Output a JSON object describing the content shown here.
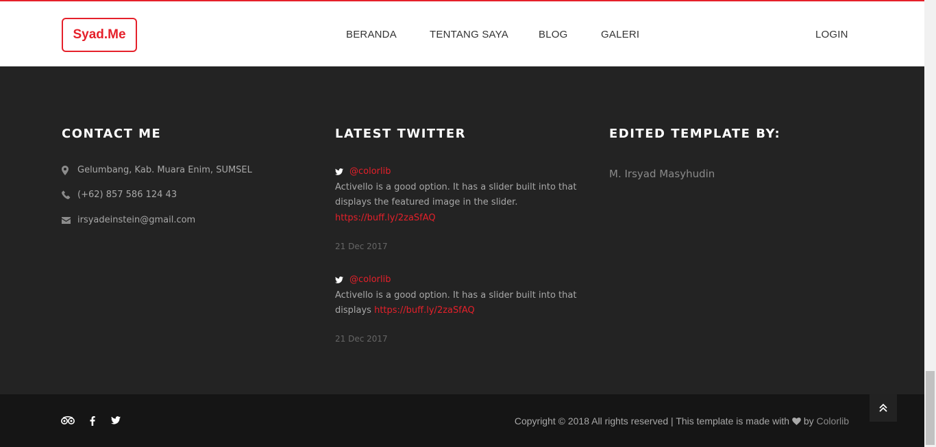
{
  "header": {
    "logo": "Syad.Me",
    "nav": [
      "BERANDA",
      "TENTANG SAYA",
      "BLOG",
      "GALERI"
    ],
    "login": "LOGIN"
  },
  "contact": {
    "title": "CONTACT ME",
    "address": "Gelumbang, Kab. Muara Enim, SUMSEL",
    "phone": "(+62) 857 586 124 43",
    "email": "irsyadeinstein@gmail.com"
  },
  "twitter": {
    "title": "LATEST TWITTER",
    "tweets": [
      {
        "handle": "@colorlib",
        "text": "Activello is a good option. It has a slider built into that displays the featured image in the slider. ",
        "link": "https://buff.ly/2zaSfAQ",
        "date": "21 Dec 2017"
      },
      {
        "handle": "@colorlib",
        "text": "Activello is a good option. It has a slider built into that displays ",
        "link": "https://buff.ly/2zaSfAQ",
        "date": "21 Dec 2017"
      }
    ]
  },
  "edited": {
    "title": "EDITED TEMPLATE BY:",
    "name": "M. Irsyad Masyhudin"
  },
  "footer": {
    "copyright_prefix": "Copyright © 2018 All rights reserved | This template is made with ",
    "by": " by ",
    "brand": "Colorlib"
  },
  "icons": {
    "address": "map-marker-icon",
    "phone": "phone-icon",
    "email": "envelope-icon",
    "tweet": "twitter-icon",
    "social": [
      "tripadvisor-icon",
      "facebook-icon",
      "twitter-icon"
    ],
    "heart": "heart-icon",
    "totop": "double-chevron-up-icon"
  },
  "colors": {
    "accent": "#e5202a",
    "footer_bg": "#232323",
    "bottom_bg": "#151515"
  }
}
